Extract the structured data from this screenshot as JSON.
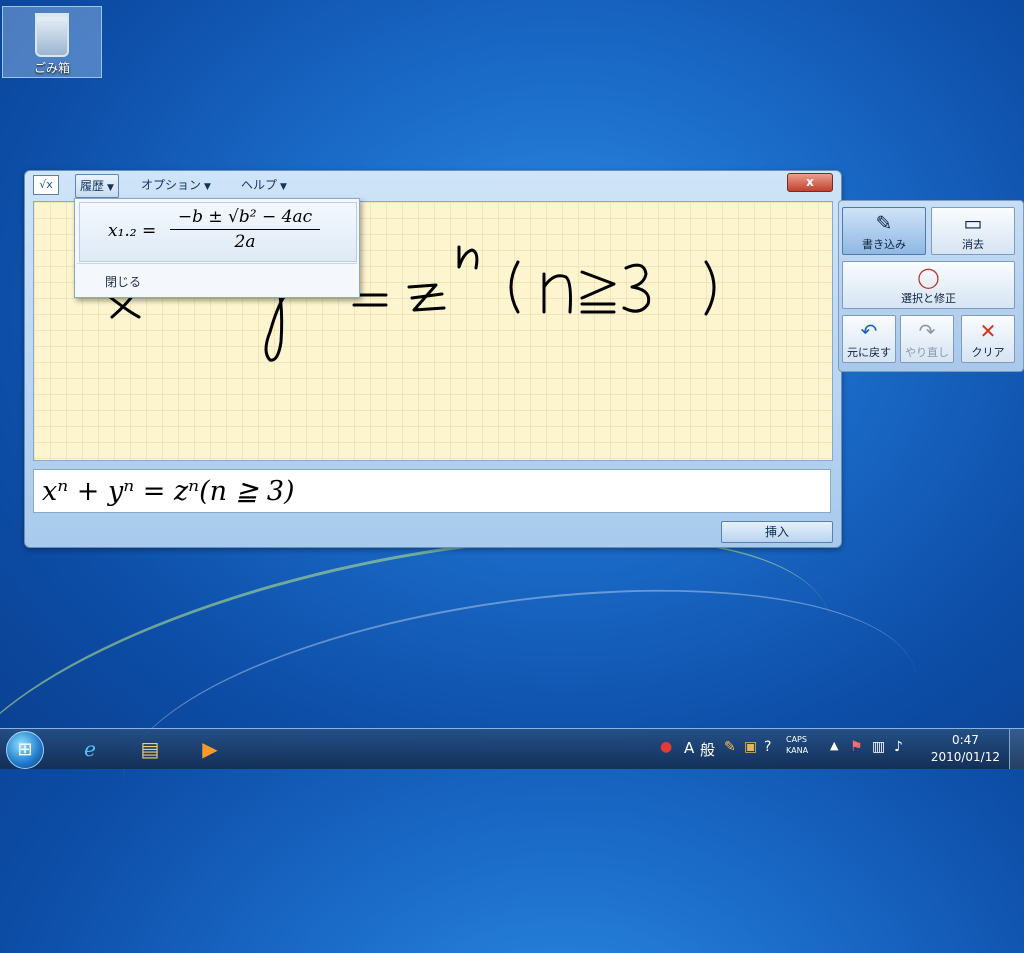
{
  "desktop": {
    "icons": [
      {
        "label": "ごみ箱",
        "icon": "recycle-bin-icon"
      }
    ]
  },
  "tip": {
    "menus": [
      {
        "label": "履歴"
      },
      {
        "label": "オプション"
      },
      {
        "label": "ヘルプ"
      }
    ],
    "close_label": "x",
    "history_dropdown": {
      "item_formula": {
        "lhs": "x₁.₂ =",
        "numerator": "−b ± √b² − 4ac",
        "denominator": "2a"
      },
      "close_label": "閉じる"
    },
    "preview_text": "xⁿ + yⁿ = zⁿ(n ≧ 3)",
    "insert_label": "挿入"
  },
  "toolbox": {
    "write_label": "書き込み",
    "erase_label": "消去",
    "select_label": "選択と修正",
    "undo_label": "元に戻す",
    "redo_label": "やり直し",
    "clear_label": "クリア"
  },
  "taskbar": {
    "pinned": [
      "internet-explorer-icon",
      "explorer-icon",
      "media-player-icon"
    ],
    "tray": {
      "ime_mode": "A",
      "ime_label": "般",
      "caps": "CAPS",
      "kana": "KANA",
      "time": "0:47",
      "date": "2010/01/12"
    }
  },
  "colors": {
    "accent": "#1b6cc9",
    "close_red": "#c3412c",
    "writing_pad": "#fdf5cf"
  }
}
